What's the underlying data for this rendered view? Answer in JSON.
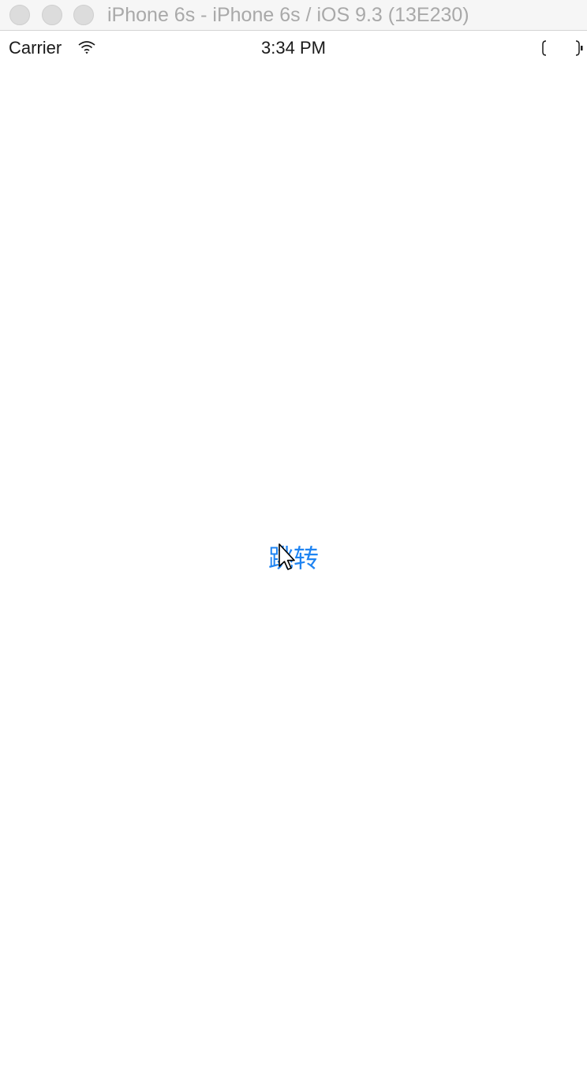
{
  "window": {
    "title": "iPhone 6s - iPhone 6s / iOS 9.3 (13E230)"
  },
  "statusbar": {
    "carrier": "Carrier",
    "time": "3:34 PM",
    "wifi_icon": "wifi-icon",
    "battery_icon": "battery-icon"
  },
  "main": {
    "jump_button_label": "跳转"
  },
  "colors": {
    "accent": "#1f84f2",
    "title_text": "#a9a9a9",
    "titlebar_bg": "#f6f6f6"
  }
}
